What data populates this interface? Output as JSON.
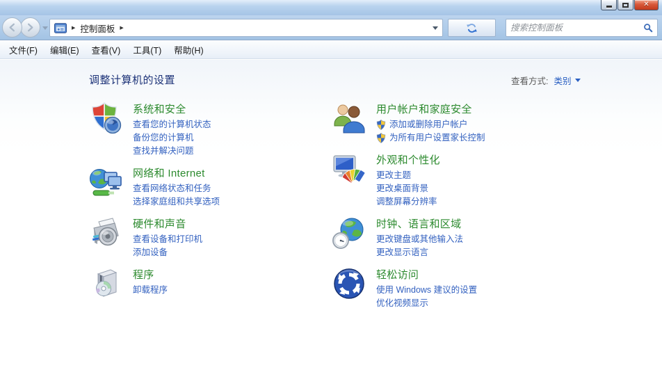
{
  "window": {
    "controls": [
      "minimize",
      "maximize",
      "close"
    ]
  },
  "address_bar": {
    "breadcrumb_root": "控制面板",
    "search_placeholder": "搜索控制面板"
  },
  "menu_bar": {
    "items": [
      "文件(F)",
      "编辑(E)",
      "查看(V)",
      "工具(T)",
      "帮助(H)"
    ]
  },
  "content": {
    "title": "调整计算机的设置",
    "view_by": {
      "label": "查看方式:",
      "value": "类别"
    },
    "categories": {
      "left": [
        {
          "id": "system-security",
          "heading": "系统和安全",
          "links": [
            {
              "label": "查看您的计算机状态"
            },
            {
              "label": "备份您的计算机"
            },
            {
              "label": "查找并解决问题"
            }
          ]
        },
        {
          "id": "network-internet",
          "heading": "网络和 Internet",
          "links": [
            {
              "label": "查看网络状态和任务"
            },
            {
              "label": "选择家庭组和共享选项"
            }
          ]
        },
        {
          "id": "hardware-sound",
          "heading": "硬件和声音",
          "links": [
            {
              "label": "查看设备和打印机"
            },
            {
              "label": "添加设备"
            }
          ]
        },
        {
          "id": "programs",
          "heading": "程序",
          "links": [
            {
              "label": "卸载程序"
            }
          ]
        }
      ],
      "right": [
        {
          "id": "user-accounts-family-safety",
          "heading": "用户帐户和家庭安全",
          "links": [
            {
              "label": "添加或删除用户帐户",
              "shield": true
            },
            {
              "label": "为所有用户设置家长控制",
              "shield": true
            }
          ]
        },
        {
          "id": "appearance-personalization",
          "heading": "外观和个性化",
          "links": [
            {
              "label": "更改主题"
            },
            {
              "label": "更改桌面背景"
            },
            {
              "label": "调整屏幕分辨率"
            }
          ]
        },
        {
          "id": "clock-language-region",
          "heading": "时钟、语言和区域",
          "links": [
            {
              "label": "更改键盘或其他输入法"
            },
            {
              "label": "更改显示语言"
            }
          ]
        },
        {
          "id": "ease-of-access",
          "heading": "轻松访问",
          "links": [
            {
              "label": "使用 Windows 建议的设置"
            },
            {
              "label": "优化视频显示"
            }
          ]
        }
      ]
    }
  },
  "icons": {
    "back": "back-arrow-circle",
    "forward": "forward-arrow-circle",
    "refresh": "refresh-arrows",
    "search": "magnifier",
    "control_panel": "control-panel-glyph",
    "uac_link": "security-shield",
    "system_security": "four-color-shield-with-disc",
    "network_internet": "globe-with-monitors",
    "hardware_sound": "printer-with-speaker",
    "programs": "software-box-with-cd",
    "user_accounts": "two-users",
    "appearance": "monitor-with-color-swatches",
    "clock_language": "globe-with-clock",
    "ease_of_access": "blue-circle-arrows"
  },
  "colors": {
    "titlebar_blue": "#aac6e7",
    "close_button_red": "#c13a1d",
    "category_heading_green": "#2c8a2e",
    "link_blue": "#3462c0",
    "page_title_navy": "#1c3278"
  }
}
